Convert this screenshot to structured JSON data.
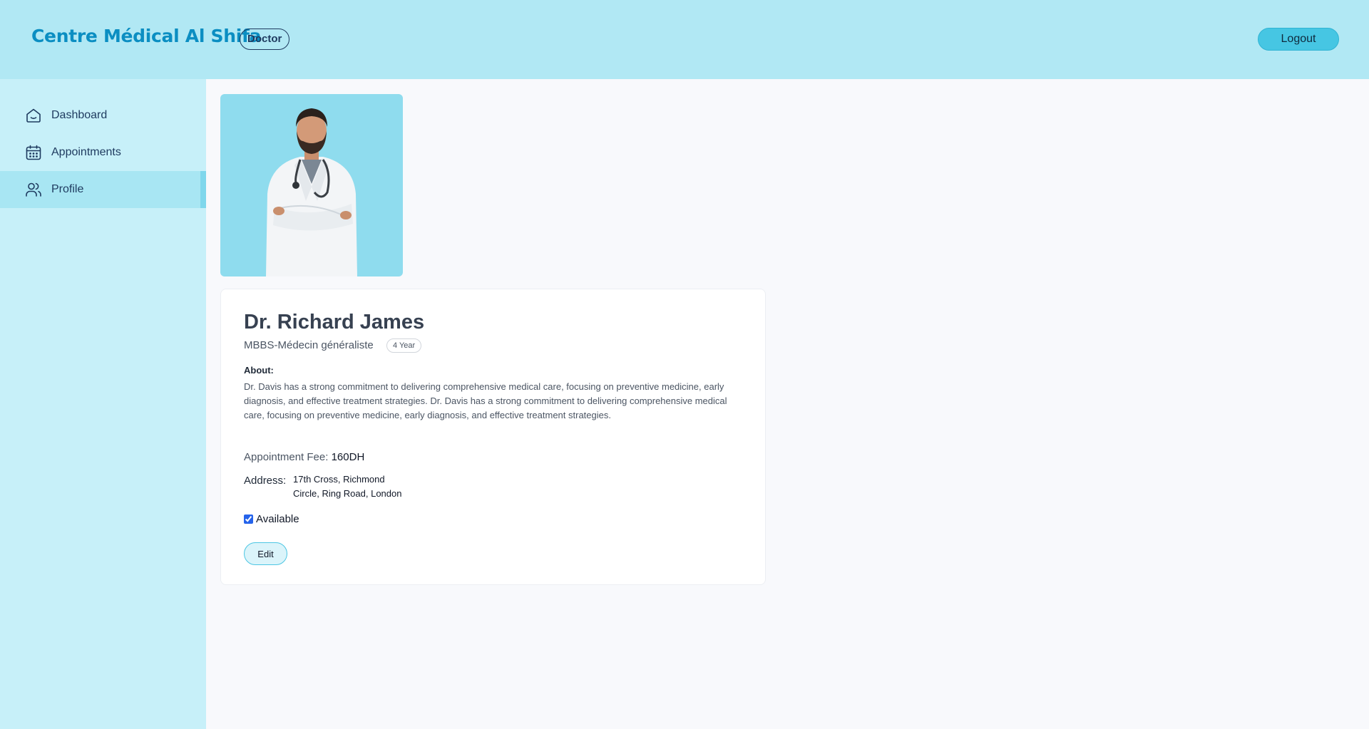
{
  "header": {
    "brand": "Centre Médical Al Shifa",
    "role_badge": "Doctor",
    "logout_label": "Logout"
  },
  "sidebar": {
    "items": [
      {
        "label": "Dashboard",
        "icon": "home-icon",
        "active": false
      },
      {
        "label": "Appointments",
        "icon": "calendar-icon",
        "active": false
      },
      {
        "label": "Profile",
        "icon": "users-icon",
        "active": true
      }
    ]
  },
  "profile": {
    "name": "Dr. Richard James",
    "degree": "MBBS-Médecin généraliste",
    "experience": "4 Year",
    "about_label": "About:",
    "about_text": "Dr. Davis has a strong commitment to delivering comprehensive medical care, focusing on preventive medicine, early diagnosis, and effective treatment strategies. Dr. Davis has a strong commitment to delivering comprehensive medical care, focusing on preventive medicine, early diagnosis, and effective treatment strategies.",
    "fee_label": "Appointment Fee:",
    "fee_value": "160DH",
    "address_label": "Address:",
    "address_line1": "17th Cross, Richmond",
    "address_line2": "Circle, Ring Road, London",
    "available_label": "Available",
    "available": true,
    "edit_label": "Edit"
  },
  "colors": {
    "header_bg": "#b1e8f4",
    "sidebar_bg": "#c7f0f9",
    "accent": "#46c6e3",
    "brand_text": "#0b8ec2"
  }
}
